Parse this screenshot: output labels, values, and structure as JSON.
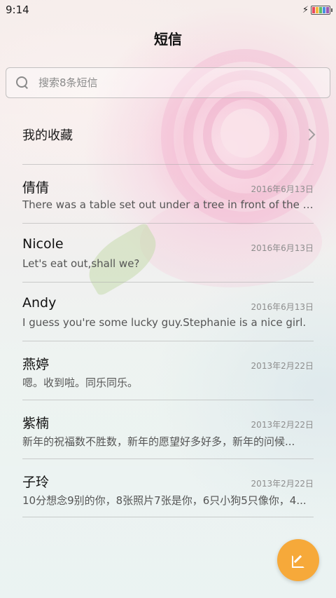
{
  "status_bar": {
    "time": "9:14",
    "battery_colors": [
      "#e84a5f",
      "#f6b93b",
      "#5bbf6a",
      "#4a90e2",
      "#9b59b6"
    ]
  },
  "header": {
    "title": "短信"
  },
  "search": {
    "placeholder": "搜索8条短信",
    "value": ""
  },
  "favorites": {
    "label": "我的收藏"
  },
  "messages": [
    {
      "name": "倩倩",
      "date": "2016年6月13日",
      "preview": "There was a table set out under a tree in front of the ho..."
    },
    {
      "name": "Nicole",
      "date": "2016年6月13日",
      "preview": "Let's eat out,shall we?"
    },
    {
      "name": "Andy",
      "date": "2016年6月13日",
      "preview": "I guess you're some lucky guy.Stephanie is a nice girl."
    },
    {
      "name": "燕婷",
      "date": "2013年2月22日",
      "preview": "嗯。收到啦。同乐同乐。"
    },
    {
      "name": "紫楠",
      "date": "2013年2月22日",
      "preview": "新年的祝福数不胜数，新年的愿望好多好多，新年的问候..."
    },
    {
      "name": "子玲",
      "date": "2013年2月22日",
      "preview": "10分想念9别的你，8张照片7张是你，6只小狗5只像你，4..."
    }
  ],
  "compose": {
    "icon": "compose-icon",
    "color": "#f6a93a"
  }
}
